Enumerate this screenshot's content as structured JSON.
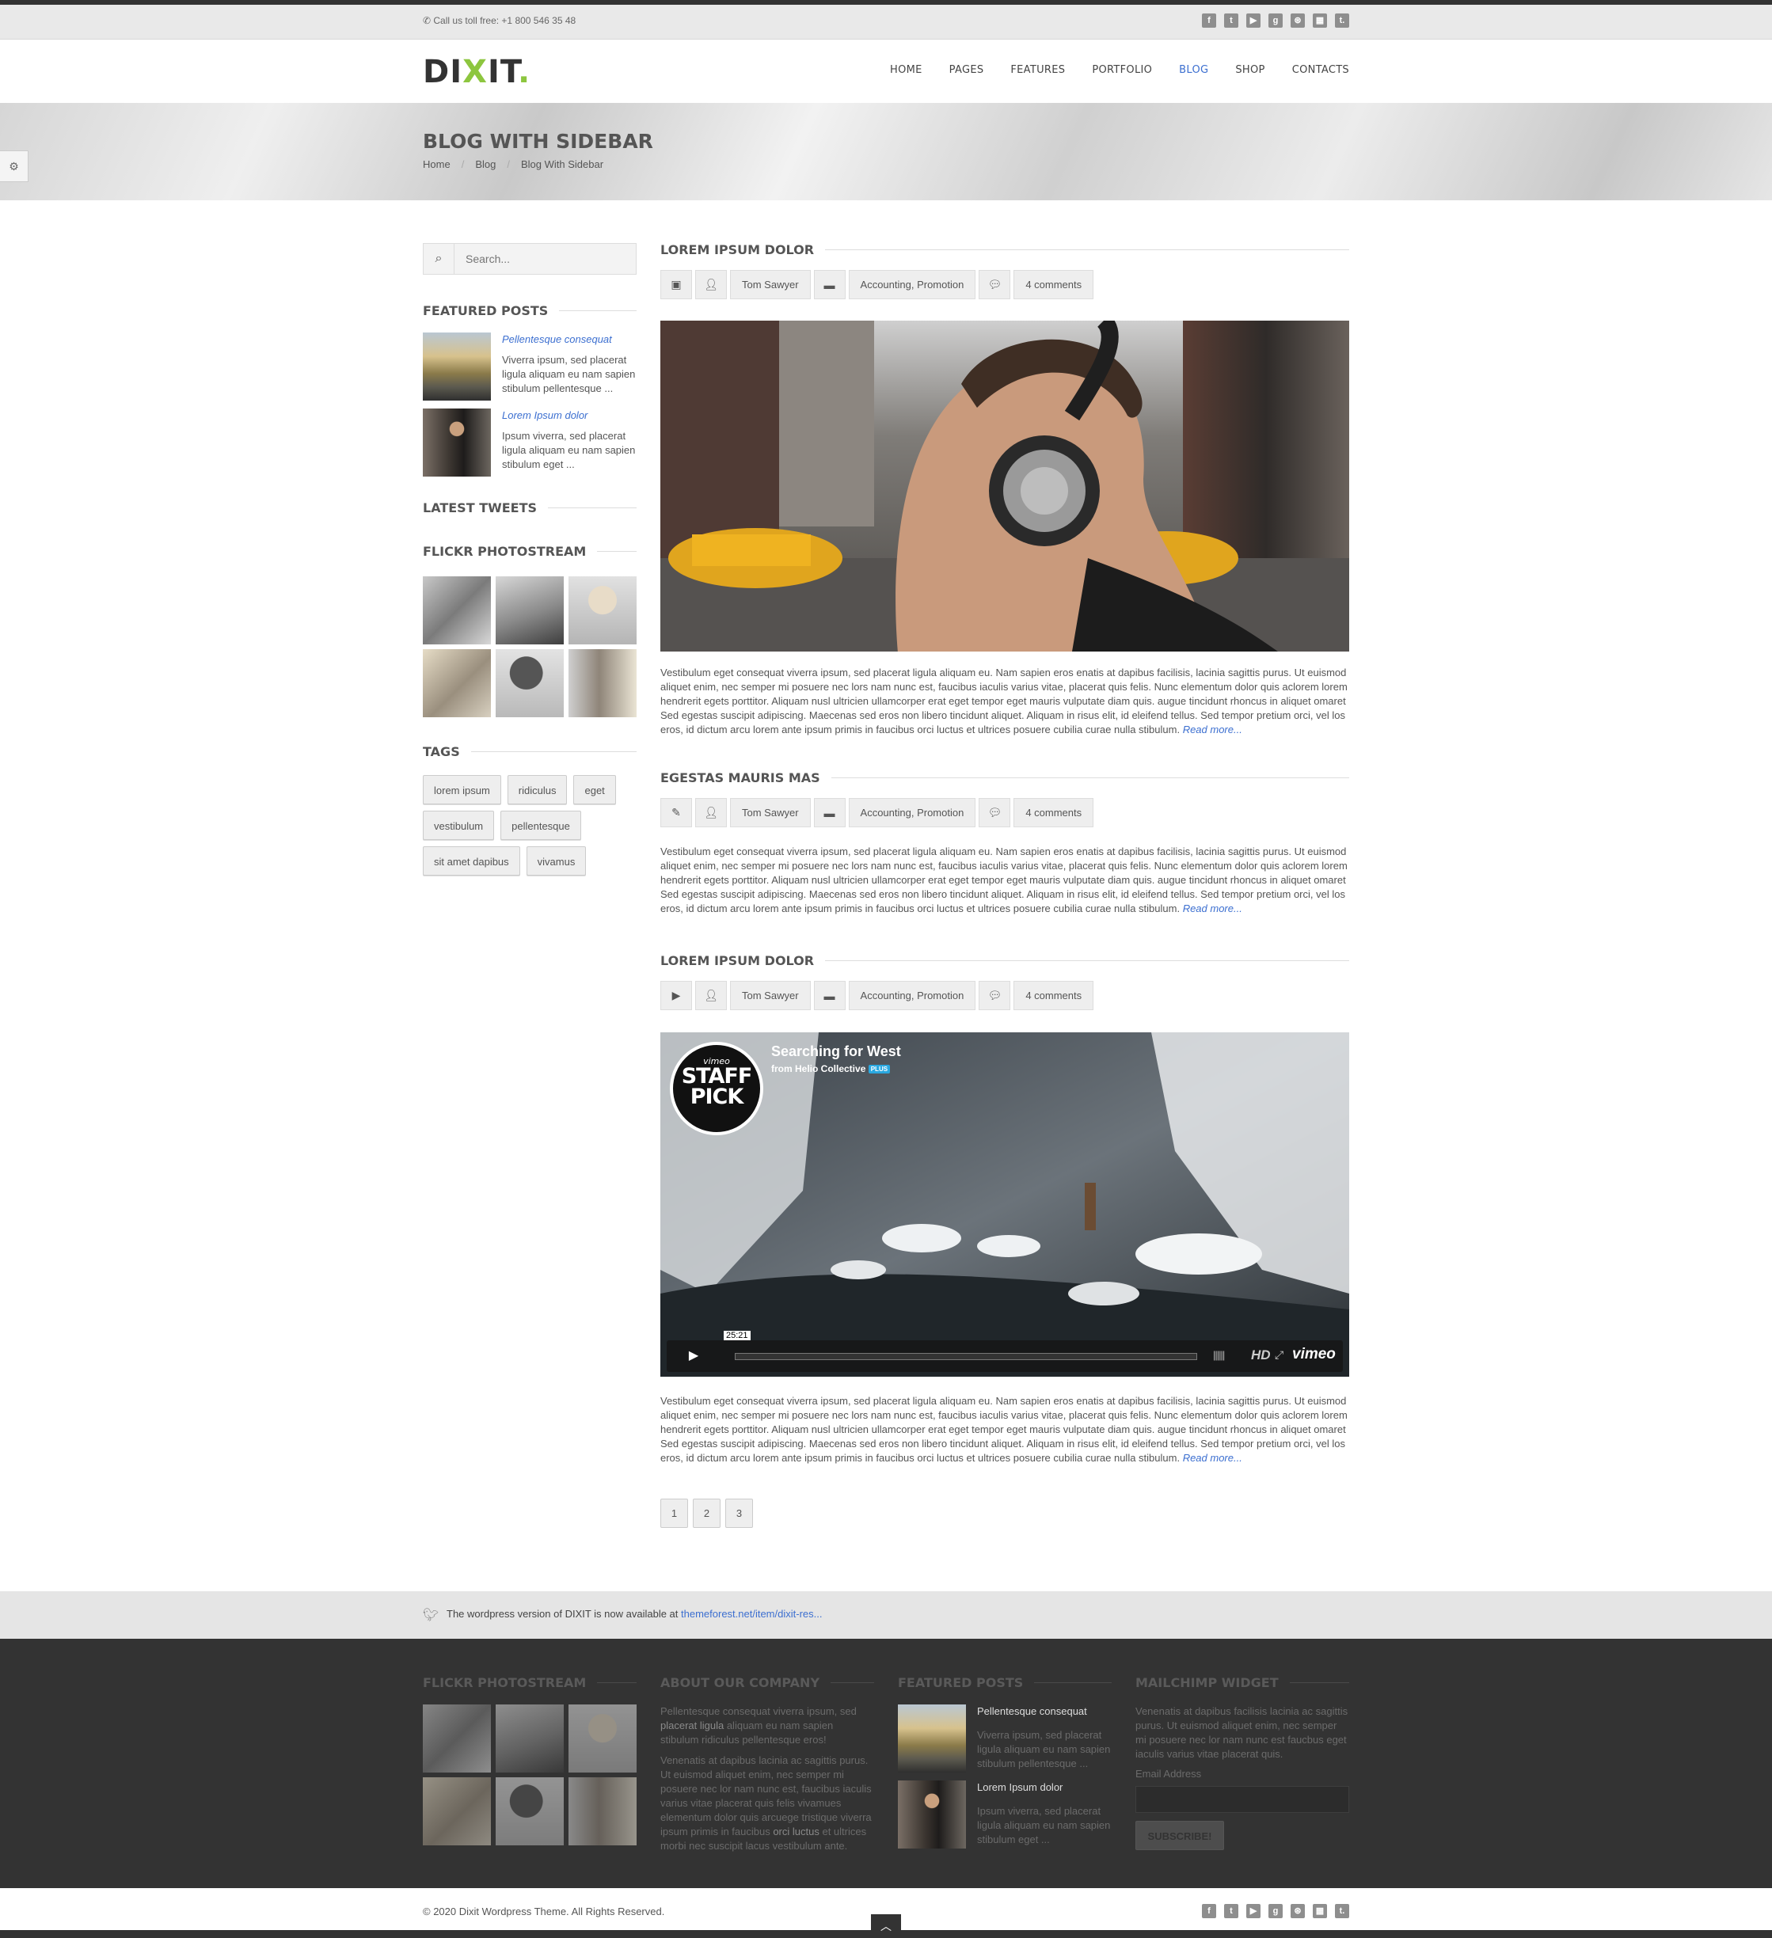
{
  "topbar": {
    "phone_label": "✆ Call us toll free:  +1 800 546 35 48",
    "social_icons": [
      "facebook-icon",
      "twitter-icon",
      "youtube-icon",
      "google-plus-icon",
      "dribbble-icon",
      "delicious-icon",
      "tumblr-icon"
    ],
    "social_glyphs": [
      "f",
      "t",
      "▶",
      "g",
      "⊛",
      "▦",
      "t."
    ]
  },
  "header": {
    "logo_main": "DI",
    "logo_x": "X",
    "logo_end": "IT",
    "logo_dot": ".",
    "nav": [
      "HOME",
      "PAGES",
      "FEATURES",
      "PORTFOLIO",
      "BLOG",
      "SHOP",
      "CONTACTS"
    ],
    "active_nav": "BLOG",
    "accent_color": "#3c6fd0",
    "brand_color": "#8dc63f"
  },
  "page_title": {
    "title": "BLOG WITH SIDEBAR",
    "breadcrumbs": [
      "Home",
      "Blog",
      "Blog With Sidebar"
    ]
  },
  "sidebar": {
    "search_placeholder": "Search...",
    "featured_title": "FEATURED POSTS",
    "featured_posts": [
      {
        "title": "Pellentesque consequat",
        "excerpt": "Viverra ipsum, sed placerat ligula aliquam eu nam sapien stibulum pellentesque ..."
      },
      {
        "title": "Lorem Ipsum dolor",
        "excerpt": "Ipsum viverra, sed placerat ligula aliquam eu nam sapien stibulum eget ..."
      }
    ],
    "tweets_title": "LATEST TWEETS",
    "flickr_title": "FLICKR PHOTOSTREAM",
    "tags_title": "TAGS",
    "tags": [
      "lorem ipsum",
      "ridiculus",
      "eget",
      "vestibulum",
      "pellentesque",
      "sit amet dapibus",
      "vivamus"
    ]
  },
  "posts": [
    {
      "title": "LOREM IPSUM DOLOR",
      "format_icon": "image-icon",
      "author": "Tom Sawyer",
      "categories": "Accounting, Promotion",
      "comments": "4 comments",
      "body": "Vestibulum eget consequat viverra ipsum, sed placerat ligula aliquam eu. Nam sapien eros enatis at dapibus facilisis, lacinia sagittis purus. Ut euismod aliquet enim, nec semper mi posuere nec lors nam nunc est, faucibus iaculis varius vitae, placerat quis felis. Nunc elementum dolor quis aclorem lorem hendrerit egets porttitor. Aliquam nusl ultricien ullamcorper erat eget tempor eget mauris vulputate diam quis. augue tincidunt rhoncus in aliquet omaret Sed egestas suscipit adipiscing. Maecenas sed eros non libero tincidunt aliquet. Aliquam in risus elit, id eleifend tellus. Sed tempor pretium orci, vel los eros, id dictum arcu lorem ante ipsum primis in faucibus orci luctus et ultrices posuere cubilia curae nulla stibulum.",
      "read_more": "Read more..."
    },
    {
      "title": "EGESTAS MAURIS MAS",
      "format_icon": "pencil-icon",
      "author": "Tom Sawyer",
      "categories": "Accounting, Promotion",
      "comments": "4 comments",
      "body": "Vestibulum eget consequat viverra ipsum, sed placerat ligula aliquam eu. Nam sapien eros enatis at dapibus facilisis, lacinia sagittis purus. Ut euismod aliquet enim, nec semper mi posuere nec lors nam nunc est, faucibus iaculis varius vitae, placerat quis felis. Nunc elementum dolor quis aclorem lorem hendrerit egets porttitor. Aliquam nusl ultricien ullamcorper erat eget tempor eget mauris vulputate diam quis. augue tincidunt rhoncus in aliquet omaret Sed egestas suscipit adipiscing. Maecenas sed eros non libero tincidunt aliquet. Aliquam in risus elit, id eleifend tellus. Sed tempor pretium orci, vel los eros, id dictum arcu lorem ante ipsum primis in faucibus orci luctus et ultrices posuere cubilia curae nulla stibulum.",
      "read_more": "Read more..."
    },
    {
      "title": "LOREM IPSUM DOLOR",
      "format_icon": "play-icon",
      "author": "Tom Sawyer",
      "categories": "Accounting, Promotion",
      "comments": "4 comments",
      "body": "Vestibulum eget consequat viverra ipsum, sed placerat ligula aliquam eu. Nam sapien eros enatis at dapibus facilisis, lacinia sagittis purus. Ut euismod aliquet enim, nec semper mi posuere nec lors nam nunc est, faucibus iaculis varius vitae, placerat quis felis. Nunc elementum dolor quis aclorem lorem hendrerit egets porttitor. Aliquam nusl ultricien ullamcorper erat eget tempor eget mauris vulputate diam quis. augue tincidunt rhoncus in aliquet omaret Sed egestas suscipit adipiscing. Maecenas sed eros non libero tincidunt aliquet. Aliquam in risus elit, id eleifend tellus. Sed tempor pretium orci, vel los eros, id dictum arcu lorem ante ipsum primis in faucibus orci luctus et ultrices posuere cubilia curae nulla stibulum.",
      "read_more": "Read more..."
    }
  ],
  "video": {
    "title": "Searching for West",
    "from": "from Helio Collective",
    "plus_badge": "PLUS",
    "badge_top": "vimeo",
    "badge_line1": "STAFF",
    "badge_line2": "PICK",
    "time": "25:21",
    "hd_label": "HD",
    "brand": "vimeo"
  },
  "pagination": [
    "1",
    "2",
    "3"
  ],
  "wp_bar": {
    "text": "The wordpress version of DIXIT is now available at ",
    "link": "themeforest.net/item/dixit-res..."
  },
  "footer": {
    "flickr_title": "FLICKR PHOTOSTREAM",
    "about_title": "ABOUT OUR COMPANY",
    "about_p1_a": "Pellentesque consequat viverra ipsum, sed ",
    "about_p1_b": "placerat ligula",
    "about_p1_c": " aliquam eu nam sapien stibulum ridiculus pellentesque eros!",
    "about_p2_a": "Venenatis at dapibus lacinia ac sagittis purus. Ut euismod aliquet enim, nec semper mi posuere nec lor nam nunc est, faucibus iaculis varius vitae placerat quis felis vivamues elementum dolor quis arcuege tristique viverra ipsum primis in faucibus ",
    "about_p2_b": "orci luctus",
    "about_p2_c": " et ultrices morbi nec suscipit lacus vestibulum ante.",
    "featured_title": "FEATURED POSTS",
    "featured_posts": [
      {
        "title": "Pellentesque consequat",
        "excerpt": "Viverra ipsum, sed placerat ligula aliquam eu nam sapien stibulum pellentesque ..."
      },
      {
        "title": "Lorem Ipsum dolor",
        "excerpt": "Ipsum viverra, sed placerat ligula aliquam eu nam sapien stibulum eget ..."
      }
    ],
    "mailchimp_title": "MAILCHIMP WIDGET",
    "mailchimp_text": "Venenatis at dapibus facilisis lacinia ac sagittis purus. Ut euismod aliquet enim, nec semper mi posuere nec lor nam nunc est faucbus eget iaculis varius vitae placerat quis.",
    "email_label": "Email Address",
    "subscribe_label": "SUBSCRIBE!"
  },
  "bottombar": {
    "copyright": "© 2020 Dixit Wordpress Theme. All Rights Reserved."
  }
}
